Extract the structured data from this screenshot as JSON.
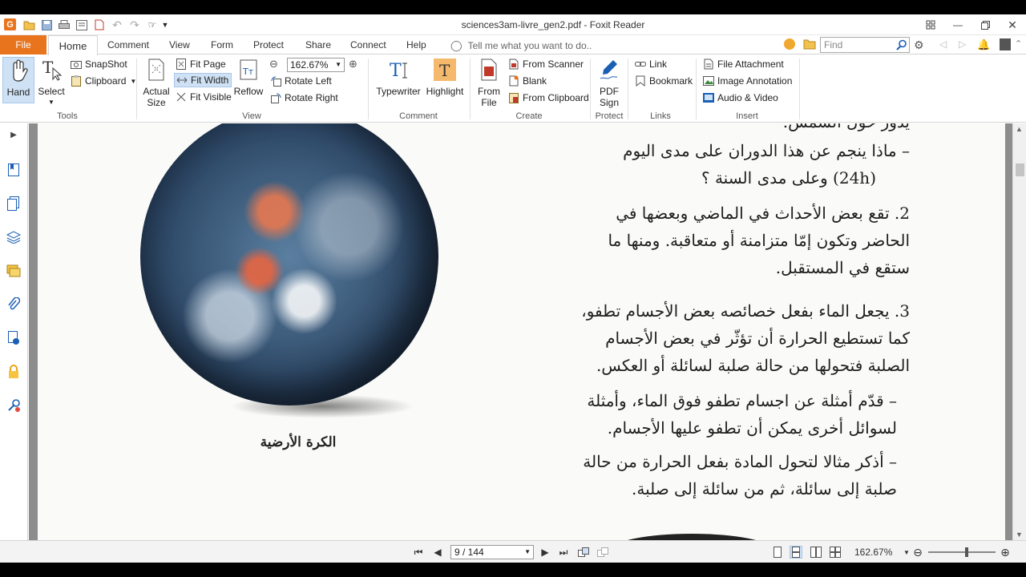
{
  "window": {
    "title": "sciences3am-livre_gen2.pdf - Foxit Reader",
    "logo_letter": "G"
  },
  "tabs": {
    "file": "File",
    "home": "Home",
    "comment": "Comment",
    "view": "View",
    "form": "Form",
    "protect": "Protect",
    "share": "Share",
    "connect": "Connect",
    "help": "Help"
  },
  "tell_me": "Tell me what you want to do..",
  "find_placeholder": "Find",
  "ribbon": {
    "tools": {
      "label": "Tools",
      "hand": "Hand",
      "select": "Select",
      "snapshot": "SnapShot",
      "clipboard": "Clipboard"
    },
    "view": {
      "label": "View",
      "actual_size_1": "Actual",
      "actual_size_2": "Size",
      "fit_page": "Fit Page",
      "fit_width": "Fit Width",
      "fit_visible": "Fit Visible",
      "reflow": "Reflow",
      "zoom_value": "162.67%",
      "rotate_left": "Rotate Left",
      "rotate_right": "Rotate Right"
    },
    "comment": {
      "label": "Comment",
      "typewriter": "Typewriter",
      "highlight": "Highlight"
    },
    "create": {
      "label": "Create",
      "from_file_1": "From",
      "from_file_2": "File",
      "from_scanner": "From Scanner",
      "blank": "Blank",
      "from_clipboard": "From Clipboard"
    },
    "protect": {
      "label": "Protect",
      "pdf_sign_1": "PDF",
      "pdf_sign_2": "Sign"
    },
    "links": {
      "label": "Links",
      "link": "Link",
      "bookmark": "Bookmark"
    },
    "insert": {
      "label": "Insert",
      "file_attachment": "File Attachment",
      "image_annotation": "Image Annotation",
      "audio_video": "Audio & Video"
    }
  },
  "document": {
    "caption": "الكرة الأرضية",
    "lines": [
      "يدور حول الشمس.",
      "– ماذا ينجم عن هذا الدوران على مدى اليوم",
      "(24h) وعلى مدى السنة ؟",
      "2. تقع بعض الأحداث في الماضي وبعضها في",
      "الحاضر وتكون إمّا متزامنة أو متعاقبة. ومنها ما",
      "ستقع في المستقبل.",
      "3. يجعل الماء بفعل خصائصه بعض الأجسام تطفو،",
      "كما تستطيع الحرارة أن تؤثّر في بعض الأجسام",
      "الصلبة فتحولها من حالة صلبة لسائلة أو العكس.",
      "– قدّم أمثلة عن اجسام تطفو فوق الماء، وأمثلة",
      "لسوائل أخرى يمكن أن تطفو عليها الأجسام.",
      "– أذكر مثالا لتحول المادة بفعل الحرارة من حالة",
      "صلبة إلى سائلة، ثم من سائلة إلى صلبة."
    ]
  },
  "status": {
    "page_value": "9 / 144",
    "zoom": "162.67%"
  },
  "colors": {
    "accent": "#e8741e",
    "active_bg": "#cfe2f5"
  }
}
